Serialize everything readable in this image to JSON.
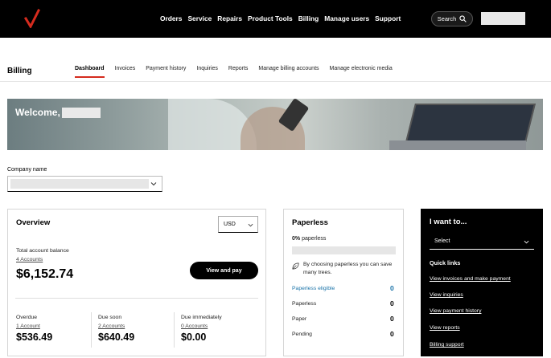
{
  "topbar": {
    "nav": [
      "Orders",
      "Service",
      "Repairs",
      "Product Tools",
      "Billing",
      "Manage users",
      "Support"
    ],
    "search_label": "Search",
    "colors": {
      "bg": "#000000",
      "brand": "#d52b1e"
    }
  },
  "billing": {
    "title": "Billing",
    "tabs": [
      "Dashboard",
      "Invoices",
      "Payment history",
      "Inquiries",
      "Reports",
      "Manage billing accounts",
      "Manage electronic media"
    ],
    "active_tab": "Dashboard"
  },
  "hero": {
    "welcome": "Welcome,"
  },
  "company": {
    "label": "Company name"
  },
  "overview": {
    "title": "Overview",
    "currency": "USD",
    "total_label": "Total account balance",
    "total_accounts": "4 Accounts",
    "total_amount": "$6,152.74",
    "pay_button": "View and pay",
    "overdue": {
      "label": "Overdue",
      "accounts": "1 Account",
      "amount": "$536.49"
    },
    "due_soon": {
      "label": "Due soon",
      "accounts": "2 Accounts",
      "amount": "$640.49"
    },
    "due_immediately": {
      "label": "Due immediately",
      "accounts": "0 Accounts",
      "amount": "$0.00"
    }
  },
  "paperless": {
    "title": "Paperless",
    "percent_bold": "0%",
    "percent_label": "paperless",
    "progress_fraction": 0,
    "note": "By choosing paperless you can save many trees.",
    "rows": [
      {
        "label": "Paperless eligible",
        "value": "0"
      },
      {
        "label": "Paperless",
        "value": "0"
      },
      {
        "label": "Paper",
        "value": "0"
      },
      {
        "label": "Pending",
        "value": "0"
      }
    ]
  },
  "iwant": {
    "title": "I want to...",
    "select_value": "Select",
    "quick_links_title": "Quick links",
    "links": [
      "View invoices and make payment",
      "View inquiries",
      "View payment history",
      "View reports",
      "Billing support"
    ]
  }
}
